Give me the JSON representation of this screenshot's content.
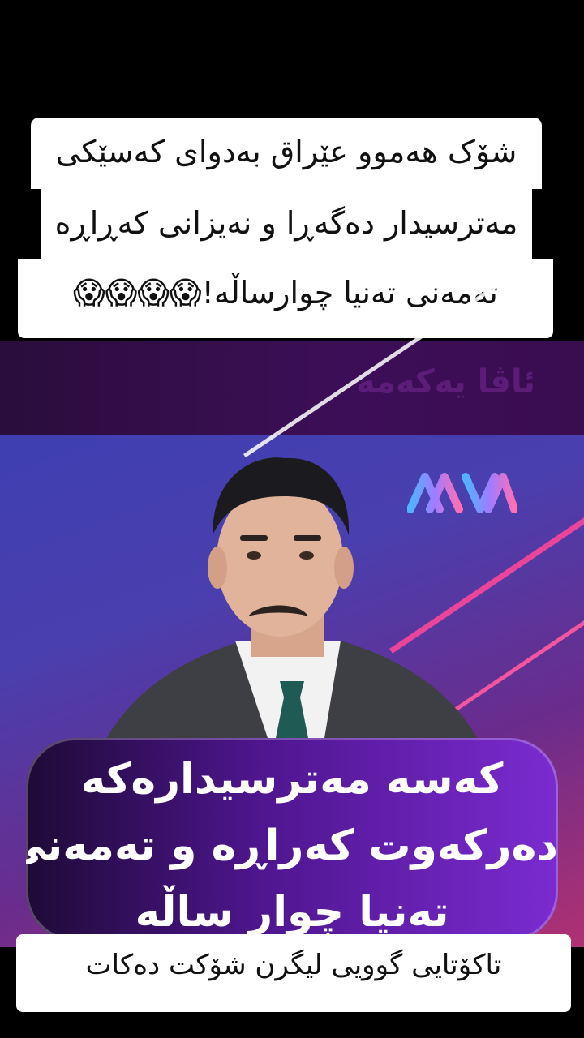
{
  "caption": {
    "line1": "شۆک هەموو عێراق بەدوای کەسێکی",
    "line2": "مەترسیدار دەگەڕا و نەیزانی کەڕاڕە",
    "line3": "تەمەنی تەنیا چوارساڵە!😱😱😱😱"
  },
  "video": {
    "topband_title": "ئاڤا یەکەمە",
    "lower_third": {
      "line1": "کەسە مەترسیدارەکە",
      "line2": "دەرکەوت کەراڕە و تەمەنی",
      "line3": "تەنیا چوار ساڵە"
    },
    "logo_icon": "ava-logo"
  },
  "bottom_caption": "تاکۆتایی گوویی لیگرن شۆکت دەکات"
}
